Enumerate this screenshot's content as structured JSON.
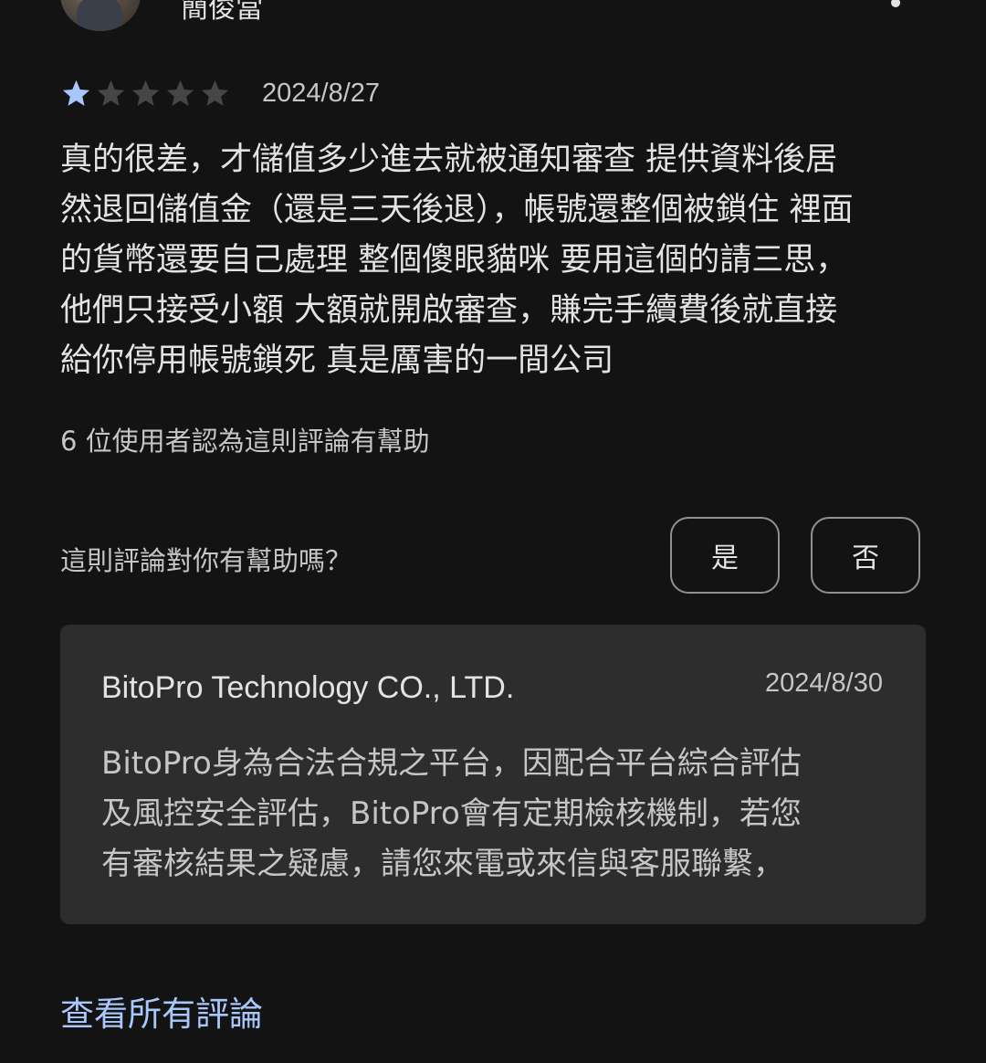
{
  "reviewer": {
    "name": "簡俊當",
    "more_icon": "more-vert-icon"
  },
  "review": {
    "rating": 1,
    "max_rating": 5,
    "date": "2024/8/27",
    "text_lines": [
      "真的很差，才儲值多少進去就被通知審查 提供資料後居",
      "然退回儲值金（還是三天後退），帳號還整個被鎖住 裡面",
      "的貨幣還要自己處理 整個傻眼貓咪 要用這個的請三思，",
      "他們只接受小額 大額就開啟審查，賺完手續費後就直接",
      "給你停用帳號鎖死 真是厲害的一間公司"
    ],
    "helpful_count_text": "6 位使用者認為這則評論有幫助"
  },
  "feedback": {
    "question": "這則評論對你有幫助嗎？",
    "yes_label": "是",
    "no_label": "否"
  },
  "developer_reply": {
    "author": "BitoPro Technology CO., LTD.",
    "date": "2024/8/30",
    "text_lines": [
      "BitoPro身為合法合規之平台，因配合平台綜合評估",
      "及風控安全評估，BitoPro會有定期檢核機制，若您",
      "有審核結果之疑慮，請您來電或來信與客服聯繫，"
    ]
  },
  "footer": {
    "see_all_label": "查看所有評論"
  },
  "colors": {
    "background": "#131313",
    "star_filled": "#a8c7fa",
    "star_empty": "#444746",
    "reply_background": "#2d2d2d",
    "link": "#a8c7fa"
  }
}
